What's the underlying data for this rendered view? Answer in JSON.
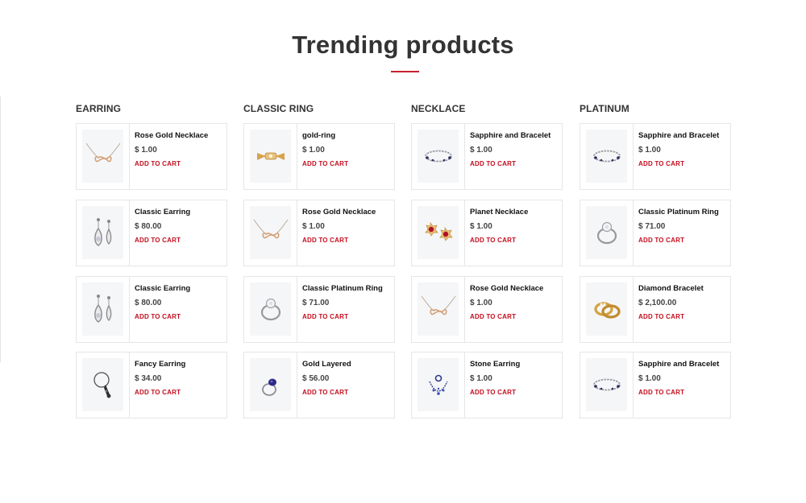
{
  "section": {
    "title": "Trending products"
  },
  "columns": [
    {
      "heading": "EARRING",
      "products": [
        {
          "name": "Rose Gold Necklace",
          "price": "$ 1.00",
          "cta": "ADD TO CART",
          "icon": "necklace-icon"
        },
        {
          "name": "Classic Earring",
          "price": "$ 80.00",
          "cta": "ADD TO CART",
          "icon": "earring-icon"
        },
        {
          "name": "Classic Earring",
          "price": "$ 80.00",
          "cta": "ADD TO CART",
          "icon": "earring-icon"
        },
        {
          "name": "Fancy Earring",
          "price": "$ 34.00",
          "cta": "ADD TO CART",
          "icon": "fancy-earring-icon"
        }
      ]
    },
    {
      "heading": "CLASSIC RING",
      "products": [
        {
          "name": "gold-ring",
          "price": "$ 1.00",
          "cta": "ADD TO CART",
          "icon": "gold-ring-icon"
        },
        {
          "name": "Rose Gold Necklace",
          "price": "$ 1.00",
          "cta": "ADD TO CART",
          "icon": "necklace-icon"
        },
        {
          "name": "Classic Platinum Ring",
          "price": "$ 71.00",
          "cta": "ADD TO CART",
          "icon": "platinum-ring-icon"
        },
        {
          "name": "Gold Layered",
          "price": "$ 56.00",
          "cta": "ADD TO CART",
          "icon": "sapphire-ring-icon"
        }
      ]
    },
    {
      "heading": "NECKLACE",
      "products": [
        {
          "name": "Sapphire and Bracelet",
          "price": "$ 1.00",
          "cta": "ADD TO CART",
          "icon": "bracelet-icon"
        },
        {
          "name": "Planet Necklace",
          "price": "$ 1.00",
          "cta": "ADD TO CART",
          "icon": "ruby-earrings-icon"
        },
        {
          "name": "Rose Gold Necklace",
          "price": "$ 1.00",
          "cta": "ADD TO CART",
          "icon": "necklace-icon"
        },
        {
          "name": "Stone Earring",
          "price": "$ 1.00",
          "cta": "ADD TO CART",
          "icon": "stone-earring-icon"
        }
      ]
    },
    {
      "heading": "PLATINUM",
      "products": [
        {
          "name": "Sapphire and Bracelet",
          "price": "$ 1.00",
          "cta": "ADD TO CART",
          "icon": "bracelet-icon"
        },
        {
          "name": "Classic Platinum Ring",
          "price": "$ 71.00",
          "cta": "ADD TO CART",
          "icon": "platinum-ring-icon"
        },
        {
          "name": "Diamond Bracelet",
          "price": "$ 2,100.00",
          "cta": "ADD TO CART",
          "icon": "gold-bands-icon"
        },
        {
          "name": "Sapphire and Bracelet",
          "price": "$ 1.00",
          "cta": "ADD TO CART",
          "icon": "bracelet-icon"
        }
      ]
    }
  ],
  "colors": {
    "accent": "#c40d1e",
    "underline": "#c8202f",
    "thumb_bg": "#f5f6f8",
    "border": "#e6e6e6"
  }
}
